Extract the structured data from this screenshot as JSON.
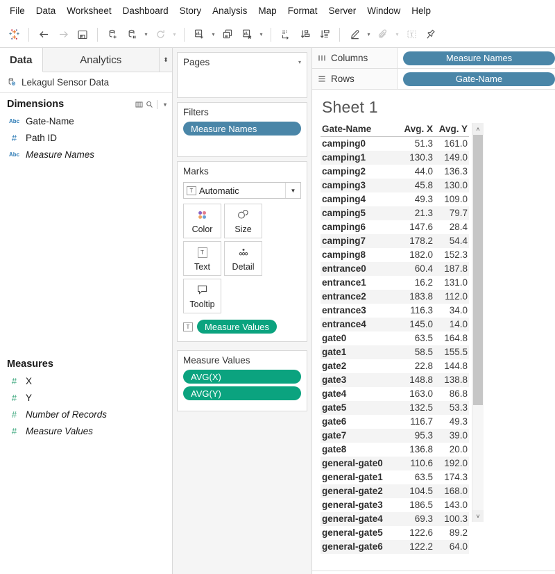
{
  "menu": {
    "items": [
      "File",
      "Data",
      "Worksheet",
      "Dashboard",
      "Story",
      "Analysis",
      "Map",
      "Format",
      "Server",
      "Window",
      "Help"
    ]
  },
  "toolbar": {
    "logo": "tableau-logo-icon",
    "buttons": [
      {
        "name": "back-button",
        "icon": "arrow-left-icon"
      },
      {
        "name": "forward-button",
        "icon": "arrow-right-icon"
      },
      {
        "name": "save-button",
        "icon": "save-disk-icon"
      },
      {
        "name": "new-data-source-button",
        "icon": "database-plus-icon"
      },
      {
        "name": "pause-auto-updates-button",
        "icon": "database-pause-icon"
      },
      {
        "name": "refresh-data-source-button",
        "icon": "refresh-circle-icon"
      },
      {
        "name": "new-worksheet-button",
        "icon": "chart-plus-icon"
      },
      {
        "name": "duplicate-sheet-button",
        "icon": "duplicate-sheet-icon"
      },
      {
        "name": "clear-sheet-button",
        "icon": "chart-clear-icon"
      },
      {
        "name": "swap-rows-columns-button",
        "icon": "swap-axes-icon"
      },
      {
        "name": "sort-ascending-button",
        "icon": "sort-ascending-icon"
      },
      {
        "name": "sort-descending-button",
        "icon": "sort-descending-icon"
      },
      {
        "name": "highlight-button",
        "icon": "highlighter-icon"
      },
      {
        "name": "group-members-button",
        "icon": "paperclip-icon"
      },
      {
        "name": "show-mark-labels-button",
        "icon": "text-label-icon"
      },
      {
        "name": "fix-axes-button",
        "icon": "pin-icon"
      }
    ]
  },
  "datapane": {
    "tabs": [
      {
        "label": "Data",
        "active": true
      },
      {
        "label": "Analytics",
        "active": false
      }
    ],
    "datasource": {
      "label": "Lekagul Sensor Data",
      "icon": "database-icon"
    },
    "dimensions": {
      "title": "Dimensions",
      "icons": [
        "grid-view-icon",
        "search-icon",
        "chevron-down-icon"
      ],
      "fields": [
        {
          "label": "Gate-Name",
          "type": "Abc",
          "italic": false
        },
        {
          "label": "Path ID",
          "type": "#",
          "italic": false
        },
        {
          "label": "Measure Names",
          "type": "Abc",
          "italic": true
        }
      ]
    },
    "measures": {
      "title": "Measures",
      "fields": [
        {
          "label": "X",
          "type": "#",
          "italic": false
        },
        {
          "label": "Y",
          "type": "#",
          "italic": false
        },
        {
          "label": "Number of Records",
          "type": "#",
          "italic": true
        },
        {
          "label": "Measure Values",
          "type": "#",
          "italic": true
        }
      ]
    }
  },
  "shelves": {
    "pages": {
      "title": "Pages",
      "contents": []
    },
    "filters": {
      "title": "Filters",
      "pills": [
        {
          "label": "Measure Names",
          "color": "blue"
        }
      ]
    },
    "marks": {
      "title": "Marks",
      "mark_type": "Automatic",
      "mark_type_icon": "text-mark-icon",
      "buttons": [
        {
          "label": "Color",
          "icon": "color-palette-icon"
        },
        {
          "label": "Size",
          "icon": "size-circle-icon"
        },
        {
          "label": "Text",
          "icon": "text-box-icon"
        },
        {
          "label": "Detail",
          "icon": "detail-dots-icon"
        },
        {
          "label": "Tooltip",
          "icon": "tooltip-bubble-icon"
        }
      ],
      "pills": [
        {
          "label": "Measure Values",
          "color": "green",
          "icon": "text-mark-icon"
        }
      ]
    },
    "measure_values": {
      "title": "Measure Values",
      "pills": [
        {
          "label": "AVG(X)",
          "color": "green"
        },
        {
          "label": "AVG(Y)",
          "color": "green"
        }
      ]
    }
  },
  "view": {
    "columns": {
      "label": "Columns",
      "icon": "columns-icon",
      "pills": [
        {
          "label": "Measure Names",
          "color": "blue"
        }
      ]
    },
    "rows": {
      "label": "Rows",
      "icon": "rows-icon",
      "pills": [
        {
          "label": "Gate-Name",
          "color": "blue"
        }
      ]
    },
    "sheet_title": "Sheet 1",
    "scrollbar": {
      "up": "chevron-up-icon",
      "down": "chevron-down-icon",
      "thumb_percent": 72
    }
  },
  "chart_data": {
    "type": "table",
    "title": "Sheet 1",
    "columns": [
      "Gate-Name",
      "Avg. X",
      "Avg. Y"
    ],
    "rows": [
      [
        "camping0",
        "51.3",
        "161.0"
      ],
      [
        "camping1",
        "130.3",
        "149.0"
      ],
      [
        "camping2",
        "44.0",
        "136.3"
      ],
      [
        "camping3",
        "45.8",
        "130.0"
      ],
      [
        "camping4",
        "49.3",
        "109.0"
      ],
      [
        "camping5",
        "21.3",
        "79.7"
      ],
      [
        "camping6",
        "147.6",
        "28.4"
      ],
      [
        "camping7",
        "178.2",
        "54.4"
      ],
      [
        "camping8",
        "182.0",
        "152.3"
      ],
      [
        "entrance0",
        "60.4",
        "187.8"
      ],
      [
        "entrance1",
        "16.2",
        "131.0"
      ],
      [
        "entrance2",
        "183.8",
        "112.0"
      ],
      [
        "entrance3",
        "116.3",
        "34.0"
      ],
      [
        "entrance4",
        "145.0",
        "14.0"
      ],
      [
        "gate0",
        "63.5",
        "164.8"
      ],
      [
        "gate1",
        "58.5",
        "155.5"
      ],
      [
        "gate2",
        "22.8",
        "144.8"
      ],
      [
        "gate3",
        "148.8",
        "138.8"
      ],
      [
        "gate4",
        "163.0",
        "86.8"
      ],
      [
        "gate5",
        "132.5",
        "53.3"
      ],
      [
        "gate6",
        "116.7",
        "49.3"
      ],
      [
        "gate7",
        "95.3",
        "39.0"
      ],
      [
        "gate8",
        "136.8",
        "20.0"
      ],
      [
        "general-gate0",
        "110.6",
        "192.0"
      ],
      [
        "general-gate1",
        "63.5",
        "174.3"
      ],
      [
        "general-gate2",
        "104.5",
        "168.0"
      ],
      [
        "general-gate3",
        "186.5",
        "143.0"
      ],
      [
        "general-gate4",
        "69.3",
        "100.3"
      ],
      [
        "general-gate5",
        "122.6",
        "89.2"
      ],
      [
        "general-gate6",
        "122.2",
        "64.0"
      ]
    ]
  },
  "colors": {
    "dimension_pill": "#4a86a8",
    "measure_pill": "#0ba37f",
    "dimension_icon": "#2b7ab5",
    "measure_icon": "#3aa77c"
  }
}
